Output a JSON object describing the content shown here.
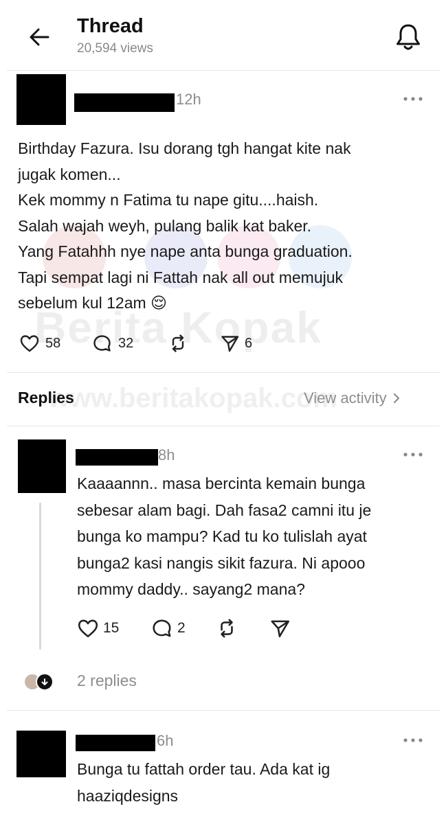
{
  "header": {
    "title": "Thread",
    "views": "20,594 views",
    "back_icon": "arrow-left-icon",
    "bell_icon": "bell-icon"
  },
  "post": {
    "time": "12h",
    "lines": [
      "Birthday Fazura. Isu dorang tgh hangat kite nak",
      "jugak komen...",
      "Kek mommy n Fatima tu nape gitu....haish.",
      "Salah wajah weyh, pulang balik kat baker.",
      "Yang Fatahhh nye nape anta bunga graduation.",
      "Tapi sempat lagi ni Fattah nak all out memujuk",
      "sebelum kul 12am 😌"
    ],
    "likes": "58",
    "comments": "32",
    "shares": "6"
  },
  "replies_section": {
    "label": "Replies",
    "view_activity": "View activity"
  },
  "reply1": {
    "time": "8h",
    "lines": [
      "Kaaaannn.. masa bercinta kemain bunga",
      "sebesar alam bagi. Dah fasa2 camni itu je",
      "bunga ko mampu? Kad tu ko tulislah ayat",
      "bunga2 kasi nangis sikit fazura. Ni apooo",
      "mommy daddy.. sayang2 mana?"
    ],
    "likes": "15",
    "comments": "2",
    "more_replies": "2 replies"
  },
  "reply2": {
    "time": "6h",
    "lines": [
      "Bunga tu fattah order tau. Ada kat ig",
      "haaziqdesigns"
    ]
  },
  "watermark": {
    "main": "Berita Kopak",
    "url": "www.beritakopak.com"
  },
  "colors": {
    "muted": "#8d8d8d",
    "divider": "#e6e6e6",
    "text": "#1a1a1a"
  }
}
